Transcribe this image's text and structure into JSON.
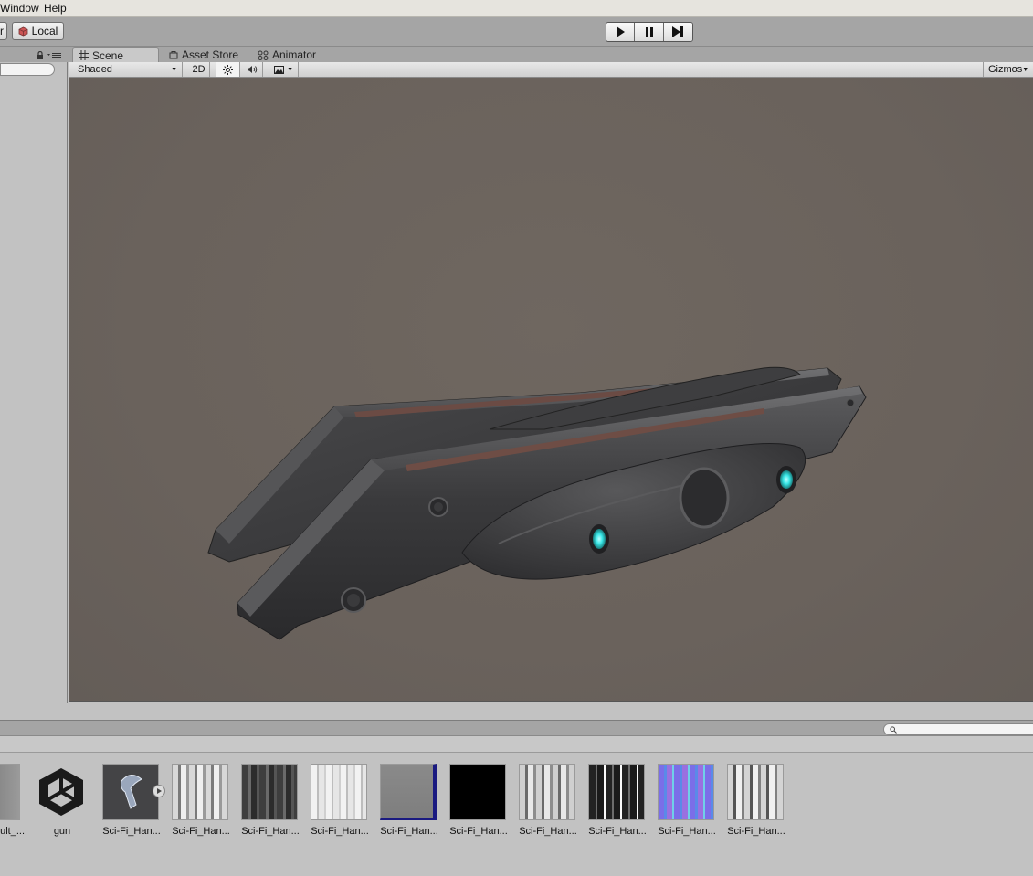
{
  "menu": {
    "items": [
      "Window",
      "Help"
    ]
  },
  "toolbar": {
    "pivot_partial_label": "r",
    "local_label": "Local",
    "play_icon": "play-icon",
    "pause_icon": "pause-icon",
    "step_icon": "step-icon"
  },
  "tabs": [
    {
      "label": "Scene",
      "icon": "grid-icon",
      "active": true
    },
    {
      "label": "Asset Store",
      "icon": "store-icon",
      "active": false
    },
    {
      "label": "Animator",
      "icon": "animator-icon",
      "active": false
    }
  ],
  "scene_toolbar": {
    "draw_mode": "Shaded",
    "mode_2d": "2D",
    "gizmos": "Gizmos"
  },
  "colors": {
    "viewport_bg": "#6a625c",
    "glow": "#37e6e6",
    "normal_map": "#7b6ee8"
  },
  "assets": [
    {
      "label": "ult_...",
      "kind": "texture-gray"
    },
    {
      "label": "gun",
      "kind": "unity-logo"
    },
    {
      "label": "Sci-Fi_Han...",
      "kind": "model-prefab"
    },
    {
      "label": "Sci-Fi_Han...",
      "kind": "texture-light"
    },
    {
      "label": "Sci-Fi_Han...",
      "kind": "texture-dark"
    },
    {
      "label": "Sci-Fi_Han...",
      "kind": "texture-white"
    },
    {
      "label": "Sci-Fi_Han...",
      "kind": "texture-flatgray"
    },
    {
      "label": "Sci-Fi_Han...",
      "kind": "texture-black"
    },
    {
      "label": "Sci-Fi_Han...",
      "kind": "texture-light"
    },
    {
      "label": "Sci-Fi_Han...",
      "kind": "texture-dark"
    },
    {
      "label": "Sci-Fi_Han...",
      "kind": "texture-normal"
    },
    {
      "label": "Sci-Fi_Han...",
      "kind": "texture-light"
    }
  ]
}
